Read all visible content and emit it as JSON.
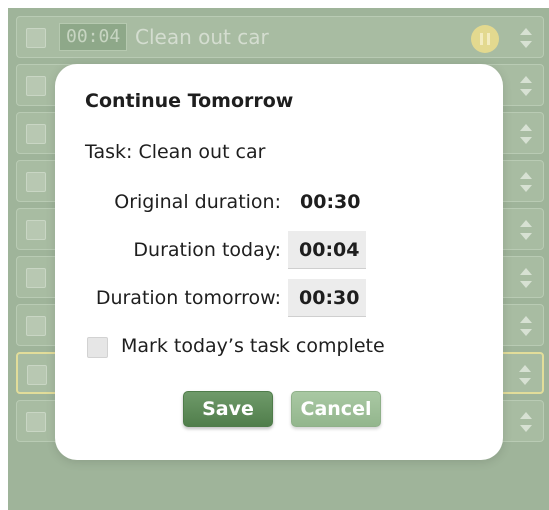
{
  "task_row": {
    "timer": "00:04",
    "title": "Clean out car"
  },
  "dialog": {
    "title": "Continue Tomorrow",
    "task_line": "Task: Clean out car",
    "original_duration_label": "Original duration:",
    "original_duration_value": "00:30",
    "duration_today_label": "Duration today:",
    "duration_today_value": "00:04",
    "duration_tomorrow_label": "Duration tomorrow:",
    "duration_tomorrow_value": "00:30",
    "mark_complete_label": "Mark today’s task complete",
    "mark_complete_checked": false,
    "save_label": "Save",
    "cancel_label": "Cancel"
  },
  "icons": {
    "pause": "pause-icon",
    "sort": "sort-arrows-icon",
    "checkbox": "checkbox-icon"
  },
  "colors": {
    "backdrop": "#9fb49a",
    "primary_button": "#5f8c5a",
    "secondary_button": "#9ebf98",
    "pause_button": "#e3d98f",
    "highlight_border": "#e2dd9a"
  }
}
